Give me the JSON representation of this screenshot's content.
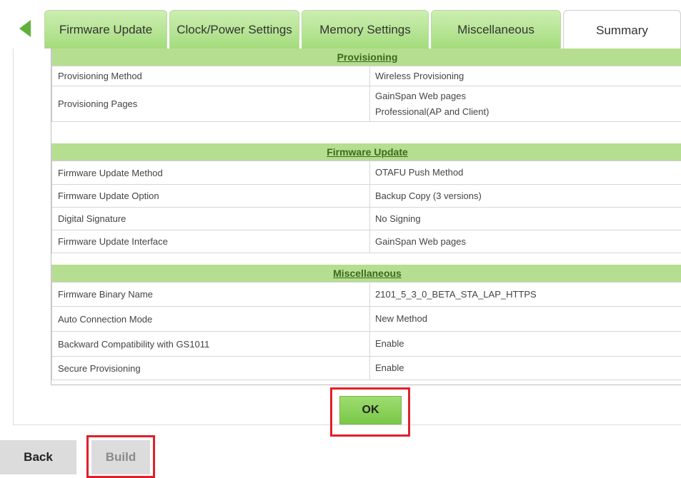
{
  "tabs": [
    {
      "label": "Firmware Update"
    },
    {
      "label": "Clock/Power Settings"
    },
    {
      "label": "Memory Settings"
    },
    {
      "label": "Miscellaneous"
    },
    {
      "label": "Summary"
    }
  ],
  "sections": [
    {
      "title": "Provisioning",
      "rows": [
        {
          "label": "Provisioning Method",
          "values": [
            "Wireless Provisioning"
          ]
        },
        {
          "label": "Provisioning Pages",
          "values": [
            "GainSpan Web pages",
            "Professional(AP and Client)"
          ]
        }
      ]
    },
    {
      "title": "Firmware Update",
      "rows": [
        {
          "label": "Firmware Update Method",
          "values": [
            "OTAFU Push Method"
          ]
        },
        {
          "label": "Firmware Update Option",
          "values": [
            "Backup Copy (3 versions)"
          ]
        },
        {
          "label": "Digital Signature",
          "values": [
            "No Signing"
          ]
        },
        {
          "label": "Firmware Update Interface",
          "values": [
            "GainSpan Web pages"
          ]
        }
      ]
    },
    {
      "title": "Miscellaneous",
      "rows": [
        {
          "label": "Firmware Binary Name",
          "values": [
            "2101_5_3_0_BETA_STA_LAP_HTTPS"
          ]
        },
        {
          "label": "Auto Connection Mode",
          "values": [
            "New Method"
          ]
        },
        {
          "label": "Backward Compatibility with GS1011",
          "values": [
            "Enable"
          ]
        },
        {
          "label": "Secure Provisioning",
          "values": [
            "Enable"
          ]
        }
      ]
    }
  ],
  "buttons": {
    "ok": "OK",
    "back": "Back",
    "build": "Build"
  },
  "colors": {
    "accent": "#79c848",
    "section_header": "#b6de90",
    "highlight": "#e0202a"
  }
}
